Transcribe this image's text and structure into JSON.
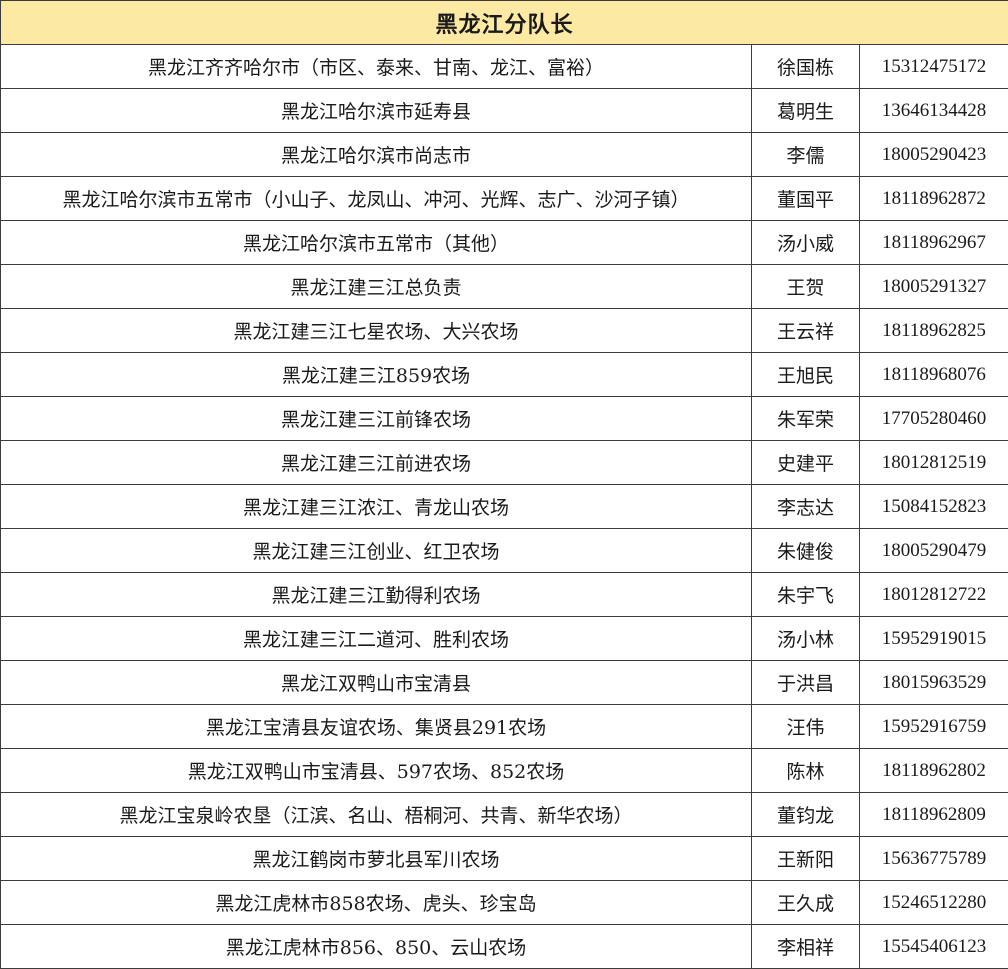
{
  "title": "黑龙江分队长",
  "rows": [
    {
      "area": "黑龙江齐齐哈尔市（市区、泰来、甘南、龙江、富裕）",
      "name": "徐国栋",
      "phone": "15312475172"
    },
    {
      "area": "黑龙江哈尔滨市延寿县",
      "name": "葛明生",
      "phone": "13646134428"
    },
    {
      "area": "黑龙江哈尔滨市尚志市",
      "name": "李儒",
      "phone": "18005290423"
    },
    {
      "area": "黑龙江哈尔滨市五常市（小山子、龙凤山、冲河、光辉、志广、沙河子镇）",
      "name": "董国平",
      "phone": "18118962872"
    },
    {
      "area": "黑龙江哈尔滨市五常市（其他）",
      "name": "汤小威",
      "phone": "18118962967"
    },
    {
      "area": "黑龙江建三江总负责",
      "name": "王贺",
      "phone": "18005291327"
    },
    {
      "area": "黑龙江建三江七星农场、大兴农场",
      "name": "王云祥",
      "phone": "18118962825"
    },
    {
      "area": "黑龙江建三江859农场",
      "name": "王旭民",
      "phone": "18118968076"
    },
    {
      "area": "黑龙江建三江前锋农场",
      "name": "朱军荣",
      "phone": "17705280460"
    },
    {
      "area": "黑龙江建三江前进农场",
      "name": "史建平",
      "phone": "18012812519"
    },
    {
      "area": "黑龙江建三江浓江、青龙山农场",
      "name": "李志达",
      "phone": "15084152823"
    },
    {
      "area": "黑龙江建三江创业、红卫农场",
      "name": "朱健俊",
      "phone": "18005290479"
    },
    {
      "area": "黑龙江建三江勤得利农场",
      "name": "朱宇飞",
      "phone": "18012812722"
    },
    {
      "area": "黑龙江建三江二道河、胜利农场",
      "name": "汤小林",
      "phone": "15952919015"
    },
    {
      "area": "黑龙江双鸭山市宝清县",
      "name": "于洪昌",
      "phone": "18015963529"
    },
    {
      "area": "黑龙江宝清县友谊农场、集贤县291农场",
      "name": "汪伟",
      "phone": "15952916759"
    },
    {
      "area": "黑龙江双鸭山市宝清县、597农场、852农场",
      "name": "陈林",
      "phone": "18118962802"
    },
    {
      "area": "黑龙江宝泉岭农垦（江滨、名山、梧桐河、共青、新华农场）",
      "name": "董钧龙",
      "phone": "18118962809"
    },
    {
      "area": "黑龙江鹤岗市萝北县军川农场",
      "name": "王新阳",
      "phone": "15636775789"
    },
    {
      "area": "黑龙江虎林市858农场、虎头、珍宝岛",
      "name": "王久成",
      "phone": "15246512280"
    },
    {
      "area": "黑龙江虎林市856、850、云山农场",
      "name": "李相祥",
      "phone": "15545406123"
    }
  ]
}
